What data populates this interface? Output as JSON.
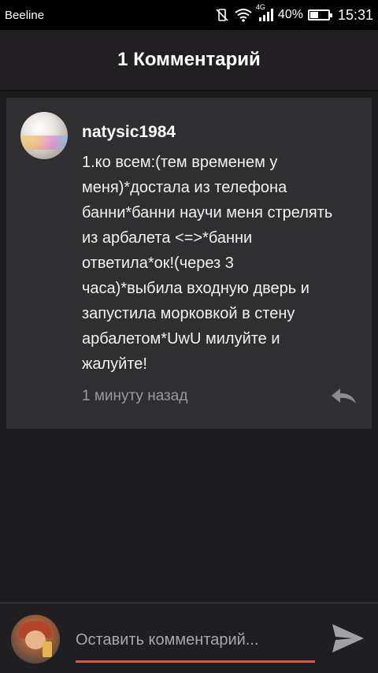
{
  "status_bar": {
    "carrier": "Beeline",
    "network": "4G",
    "battery": "40%",
    "time": "15:31"
  },
  "header": {
    "title": "1 Комментарий"
  },
  "comment": {
    "username": "natysic1984",
    "text": "1.ко всем:(тем временем у\nменя)*достала из телефона\nбанни*банни научи меня стрелять\nиз арбалета <=>*банни\nответила*ок!(через 3\nчаса)*выбила входную дверь и\nзапустила морковкой в стену\nарбалетом*UwU милуйте и\nжалуйте!",
    "timestamp": "1 минуту назад",
    "reply_icon": "reply-icon"
  },
  "composer": {
    "placeholder": "Оставить комментарий...",
    "send_icon": "send-icon"
  },
  "colors": {
    "accent": "#e0553a",
    "card_bg": "#2f2e30",
    "page_bg": "#1c1b1d"
  }
}
